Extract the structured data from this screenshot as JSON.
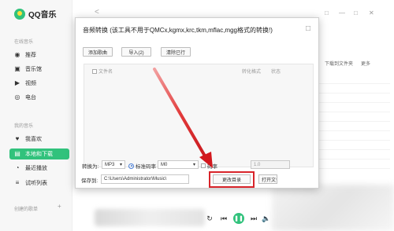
{
  "app": {
    "logo_text": "QQ音乐",
    "nav_back": "<",
    "nav_forward": ">",
    "window_controls": [
      "□",
      "—",
      "□",
      "✕"
    ]
  },
  "sidebar": {
    "section_online": "在线音乐",
    "online_items": [
      {
        "label": "推荐",
        "icon": "disc-icon"
      },
      {
        "label": "音乐馆",
        "icon": "music-hall-icon"
      },
      {
        "label": "视频",
        "icon": "video-icon"
      },
      {
        "label": "电台",
        "icon": "radio-icon"
      }
    ],
    "section_mine": "我的音乐",
    "mine_items": [
      {
        "label": "我喜欢",
        "icon": "heart-icon",
        "active": false
      },
      {
        "label": "本地和下载",
        "icon": "download-icon",
        "active": true
      },
      {
        "label": "最近播放",
        "icon": "clock-icon",
        "active": false
      },
      {
        "label": "试听列表",
        "icon": "list-icon",
        "active": false
      }
    ],
    "section_created": "创建的歌单",
    "plus": "+"
  },
  "background": {
    "download_folder": "下载到文件夹",
    "more": "更多"
  },
  "dialog": {
    "title": "音频转换 (该工具不用于QMCx,kgmx,krc,tkm,mflac,mgg格式的转换!)",
    "close": "□",
    "toolbar": {
      "add": "添加歌曲",
      "import": "导入(2)",
      "clear": "清除已行"
    },
    "list": {
      "col_filename": "文件名",
      "col_format": "转化格式",
      "col_status": "状态"
    },
    "output_format_label": "转换为:",
    "output_format_value": "MP3",
    "bitrate_option": "标准码率",
    "bitrate_value": "M0",
    "other_option": "码率",
    "other_value": "1.0",
    "save_label": "保存到:",
    "save_path": "C:\\Users\\Administrator\\Music\\",
    "change_dir": "更改目录",
    "open_dir": "打开文件夹"
  },
  "player": {
    "loop": "↻",
    "prev": "⏮",
    "play": "❚❚",
    "next": "⏭",
    "volume": "🔈"
  },
  "annotation": {
    "highlight_color": "#d8242a",
    "arrow_color": "#d8242a"
  }
}
